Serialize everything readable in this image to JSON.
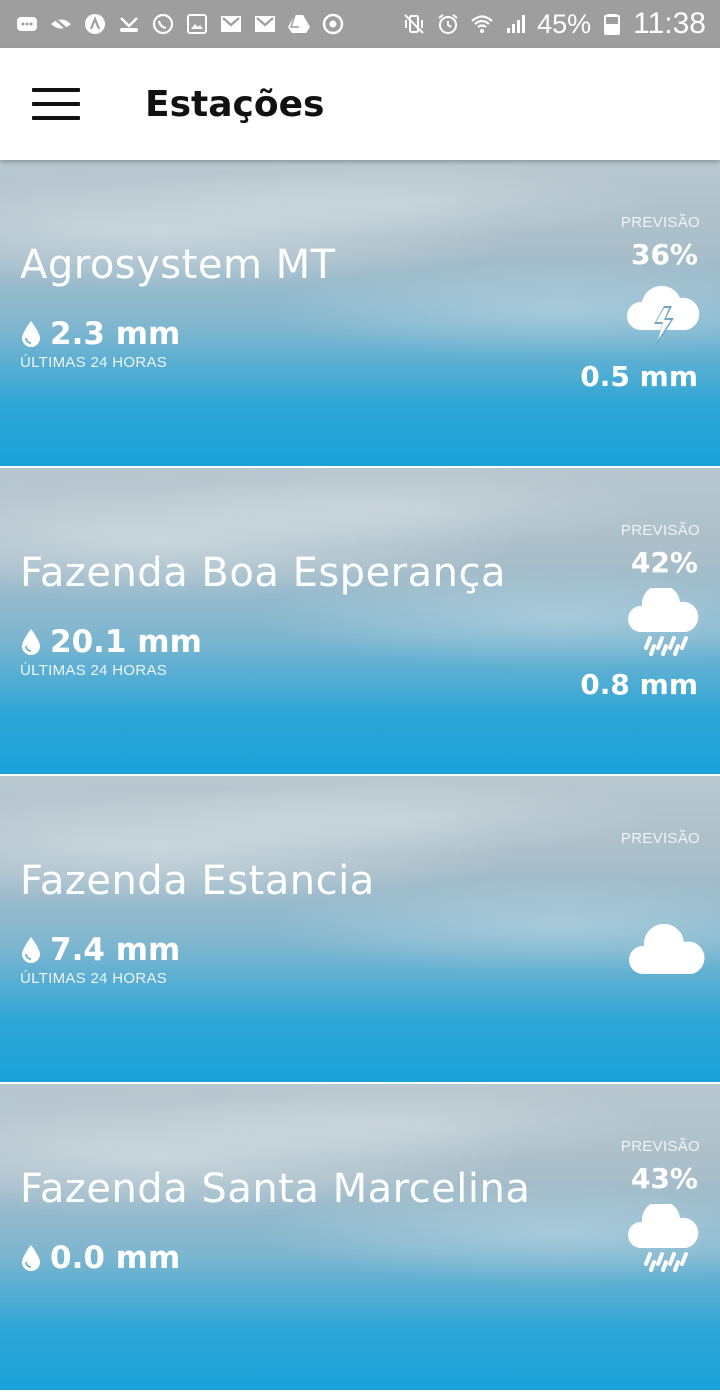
{
  "status_bar": {
    "battery": "45%",
    "time": "11:38"
  },
  "app_bar": {
    "title": "Estações"
  },
  "stations": [
    {
      "name": "Agrosystem MT",
      "rain": "2.3 mm",
      "rain_label": "ÚLTIMAS 24 HORAS",
      "forecast_label": "PREVISÃO",
      "forecast_pct": "36%",
      "forecast_icon": "thunderstorm-icon",
      "forecast_mm": "0.5 mm"
    },
    {
      "name": "Fazenda Boa Esperança",
      "rain": "20.1 mm",
      "rain_label": "ÚLTIMAS 24 HORAS",
      "forecast_label": "PREVISÃO",
      "forecast_pct": "42%",
      "forecast_icon": "rain-cloud-icon",
      "forecast_mm": "0.8 mm"
    },
    {
      "name": "Fazenda Estancia",
      "rain": "7.4 mm",
      "rain_label": "ÚLTIMAS 24 HORAS",
      "forecast_label": "PREVISÃO",
      "forecast_icon": "cloud-icon"
    },
    {
      "name": "Fazenda Santa Marcelina",
      "rain": "0.0 mm",
      "forecast_label": "PREVISÃO",
      "forecast_pct": "43%",
      "forecast_icon": "rain-cloud-icon"
    }
  ]
}
